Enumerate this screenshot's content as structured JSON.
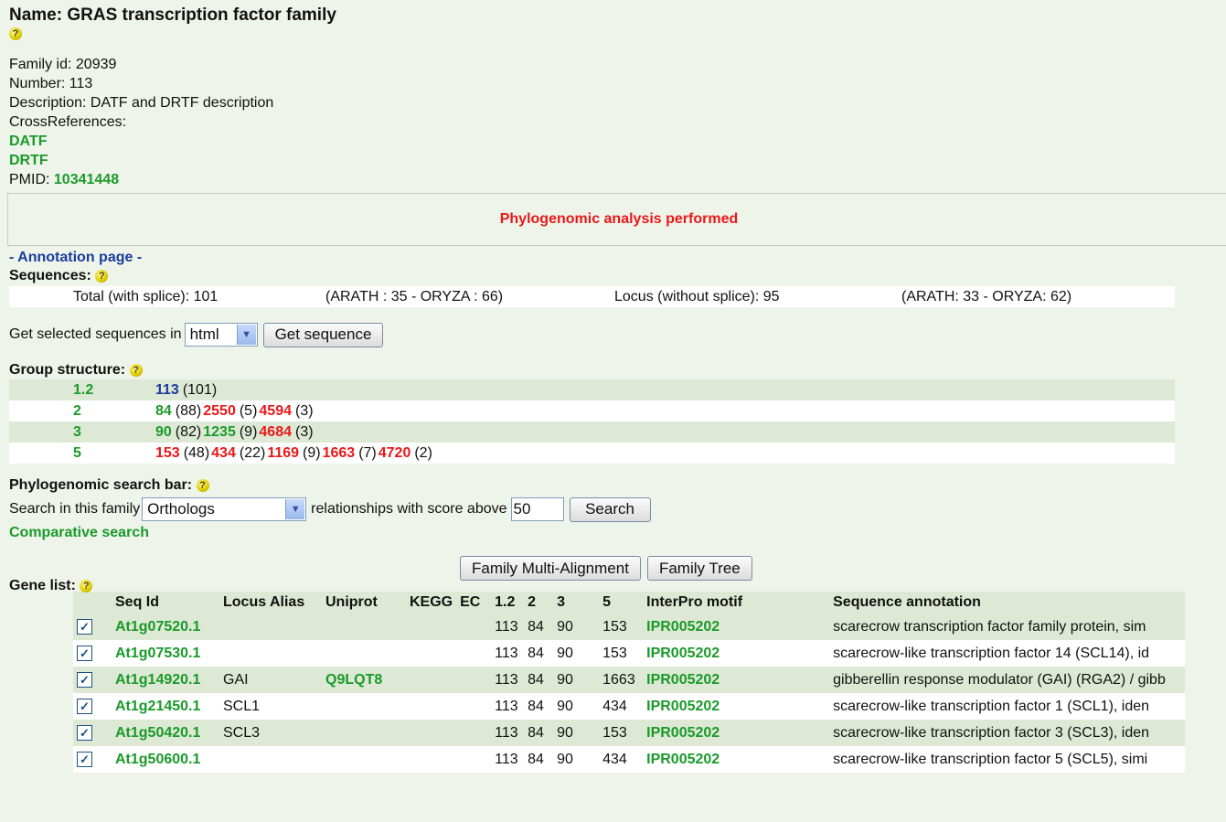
{
  "header": {
    "title": "Name: GRAS transcription factor family",
    "help": "?"
  },
  "info": {
    "family_id": "Family id: 20939",
    "number": "Number: 113",
    "description": "Description: DATF and DRTF description",
    "crossrefs_label": "CrossReferences:",
    "crossrefs": [
      "DATF",
      "DRTF"
    ],
    "pmid_label": "PMID:",
    "pmid": "10341448"
  },
  "phylo_banner": "Phylogenomic analysis performed",
  "annotation_link": "- Annotation page -",
  "sequences": {
    "label": "Sequences:",
    "total": "Total (with splice): 101",
    "total_split": "(ARATH : 35 - ORYZA : 66)",
    "locus": "Locus (without splice): 95",
    "locus_split": "(ARATH: 33 - ORYZA: 62)"
  },
  "get_sequences": {
    "label": "Get selected sequences in",
    "format": "html",
    "button": "Get sequence"
  },
  "group_structure": {
    "label": "Group structure:",
    "rows": [
      {
        "level": "1.2",
        "items": [
          {
            "id": "113",
            "count": "(101)",
            "color": "blue"
          }
        ]
      },
      {
        "level": "2",
        "items": [
          {
            "id": "84",
            "count": "(88)",
            "color": "green"
          },
          {
            "id": "2550",
            "count": "(5)",
            "color": "red"
          },
          {
            "id": "4594",
            "count": "(3)",
            "color": "red"
          }
        ]
      },
      {
        "level": "3",
        "items": [
          {
            "id": "90",
            "count": "(82)",
            "color": "green"
          },
          {
            "id": "1235",
            "count": "(9)",
            "color": "green"
          },
          {
            "id": "4684",
            "count": "(3)",
            "color": "red"
          }
        ]
      },
      {
        "level": "5",
        "items": [
          {
            "id": "153",
            "count": "(48)",
            "color": "red"
          },
          {
            "id": "434",
            "count": "(22)",
            "color": "red"
          },
          {
            "id": "1169",
            "count": "(9)",
            "color": "red"
          },
          {
            "id": "1663",
            "count": "(7)",
            "color": "red"
          },
          {
            "id": "4720",
            "count": "(2)",
            "color": "red"
          }
        ]
      }
    ]
  },
  "search_bar": {
    "label": "Phylogenomic search bar:",
    "prefix": "Search in this family",
    "relationship": "Orthologs",
    "middle": "relationships with score above",
    "score": "50",
    "button": "Search",
    "comparative": "Comparative search"
  },
  "family_buttons": {
    "alignment": "Family Multi-Alignment",
    "tree": "Family Tree"
  },
  "gene_list": {
    "label": "Gene list:",
    "columns": [
      "Seq Id",
      "Locus Alias",
      "Uniprot",
      "KEGG",
      "EC",
      "1.2",
      "2",
      "3",
      "5",
      "InterPro motif",
      "Sequence annotation"
    ],
    "rows": [
      {
        "seq": "At1g07520.1",
        "alias": "",
        "uniprot": "",
        "kegg": "",
        "ec": "",
        "g12": "113",
        "g2": "84",
        "g3": "90",
        "g5": "153",
        "interpro": "IPR005202",
        "annotation": "scarecrow transcription factor family protein, sim"
      },
      {
        "seq": "At1g07530.1",
        "alias": "",
        "uniprot": "",
        "kegg": "",
        "ec": "",
        "g12": "113",
        "g2": "84",
        "g3": "90",
        "g5": "153",
        "interpro": "IPR005202",
        "annotation": "scarecrow-like transcription factor 14 (SCL14), id"
      },
      {
        "seq": "At1g14920.1",
        "alias": "GAI",
        "uniprot": "Q9LQT8",
        "kegg": "",
        "ec": "",
        "g12": "113",
        "g2": "84",
        "g3": "90",
        "g5": "1663",
        "interpro": "IPR005202",
        "annotation": "gibberellin response modulator (GAI) (RGA2) / gibb"
      },
      {
        "seq": "At1g21450.1",
        "alias": "SCL1",
        "uniprot": "",
        "kegg": "",
        "ec": "",
        "g12": "113",
        "g2": "84",
        "g3": "90",
        "g5": "434",
        "interpro": "IPR005202",
        "annotation": "scarecrow-like transcription factor 1 (SCL1), iden"
      },
      {
        "seq": "At1g50420.1",
        "alias": "SCL3",
        "uniprot": "",
        "kegg": "",
        "ec": "",
        "g12": "113",
        "g2": "84",
        "g3": "90",
        "g5": "153",
        "interpro": "IPR005202",
        "annotation": "scarecrow-like transcription factor 3 (SCL3), iden"
      },
      {
        "seq": "At1g50600.1",
        "alias": "",
        "uniprot": "",
        "kegg": "",
        "ec": "",
        "g12": "113",
        "g2": "84",
        "g3": "90",
        "g5": "434",
        "interpro": "IPR005202",
        "annotation": "scarecrow-like transcription factor 5 (SCL5), simi"
      }
    ]
  },
  "colors": {
    "green": "#1a9a2a",
    "blue": "#1a3c9c",
    "red": "#e81818",
    "tint": "#dde9d4"
  }
}
